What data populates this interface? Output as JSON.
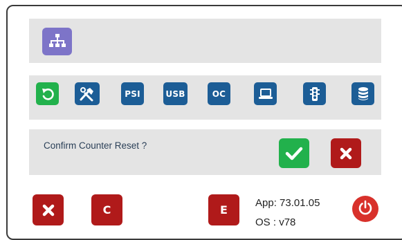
{
  "toolbar": {
    "buttons": [
      {
        "name": "reset-counter-button",
        "label": "",
        "icon": "reset-icon",
        "color": "#22b14c"
      },
      {
        "name": "calibration-button",
        "label": "",
        "icon": "tools-icon",
        "color": "#1c5d96"
      },
      {
        "name": "psi-button",
        "label": "PSI",
        "icon": "",
        "color": "#1c5d96"
      },
      {
        "name": "usb-button",
        "label": "USB",
        "icon": "",
        "color": "#1c5d96"
      },
      {
        "name": "oc-button",
        "label": "OC",
        "icon": "",
        "color": "#1c5d96"
      },
      {
        "name": "laptop-button",
        "label": "",
        "icon": "laptop-icon",
        "color": "#1c5d96"
      },
      {
        "name": "signal-button",
        "label": "",
        "icon": "traffic-light-icon",
        "color": "#1c5d96"
      },
      {
        "name": "database-button",
        "label": "",
        "icon": "database-icon",
        "color": "#1c5d96"
      }
    ]
  },
  "top": {
    "icon": "sitemap-icon",
    "color": "#7d74c8"
  },
  "confirm": {
    "message": "Confirm Counter Reset ?",
    "ok_icon": "check-icon",
    "cancel_icon": "close-icon"
  },
  "footer": {
    "left_buttons": [
      {
        "name": "clear-button",
        "label": "",
        "icon": "close-icon"
      },
      {
        "name": "c-button",
        "label": "C"
      },
      {
        "name": "e-button",
        "label": "E"
      }
    ],
    "app_label": "App:",
    "app_version": "73.01.05",
    "os_label": "OS :",
    "os_version": "v78",
    "power_icon": "power-icon"
  },
  "colors": {
    "band": "#e4e4e4",
    "blue": "#1c5d96",
    "green": "#22b14c",
    "red": "#b01a1a",
    "power": "#d8312b"
  }
}
